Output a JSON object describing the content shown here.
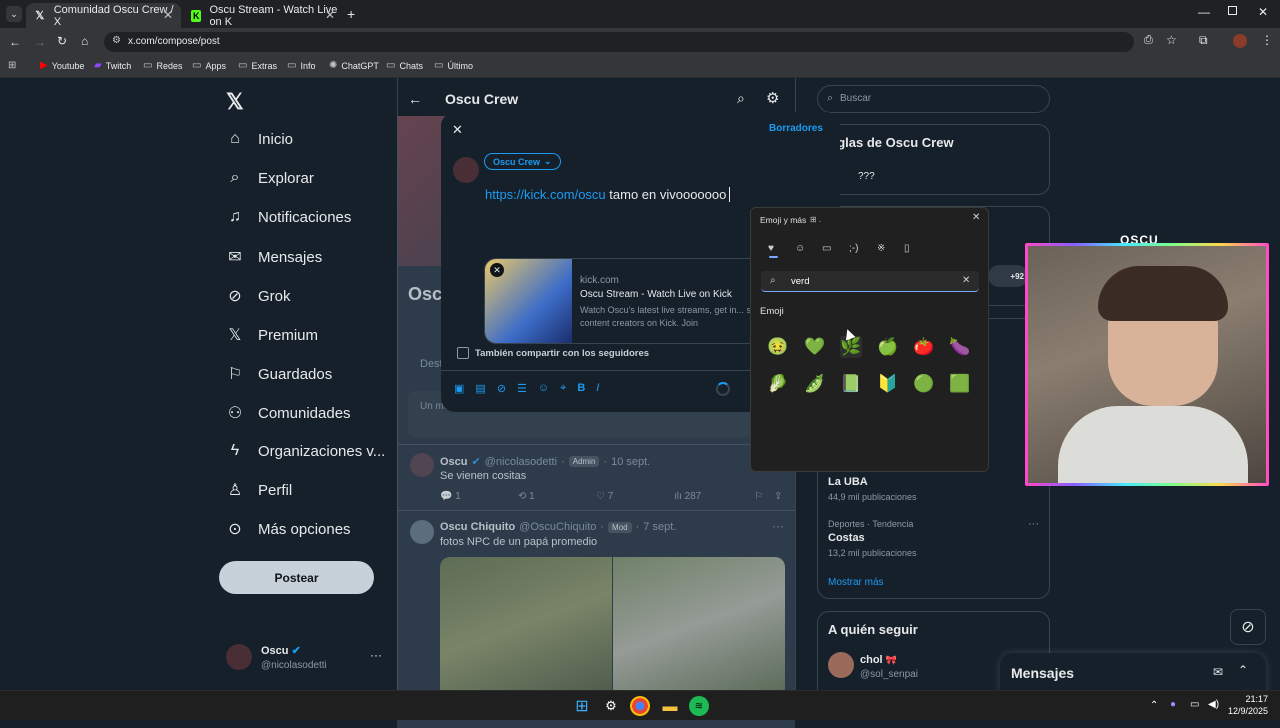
{
  "browser": {
    "tabs": [
      {
        "label": "Comunidad Oscu Crew / X",
        "icon": "x-logo-icon",
        "active": true
      },
      {
        "label": "Oscu Stream - Watch Live on K",
        "icon": "kick-logo-icon",
        "active": false
      }
    ],
    "url": "x.com/compose/post",
    "bookmarks": [
      {
        "label": "Youtube",
        "icon": "youtube-icon"
      },
      {
        "label": "Twitch",
        "icon": "twitch-icon"
      },
      {
        "label": "Redes",
        "icon": "folder-icon"
      },
      {
        "label": "Apps",
        "icon": "folder-icon"
      },
      {
        "label": "Extras",
        "icon": "folder-icon"
      },
      {
        "label": "Info",
        "icon": "folder-icon"
      },
      {
        "label": "ChatGPT",
        "icon": "chatgpt-icon"
      },
      {
        "label": "Chats",
        "icon": "folder-icon"
      },
      {
        "label": "Último",
        "icon": "folder-icon"
      }
    ]
  },
  "sidebar": {
    "items": [
      {
        "label": "Inicio",
        "icon": "home-icon"
      },
      {
        "label": "Explorar",
        "icon": "search-icon"
      },
      {
        "label": "Notificaciones",
        "icon": "bell-icon"
      },
      {
        "label": "Mensajes",
        "icon": "mail-icon"
      },
      {
        "label": "Grok",
        "icon": "grok-icon"
      },
      {
        "label": "Premium",
        "icon": "x-logo-icon"
      },
      {
        "label": "Guardados",
        "icon": "bookmark-icon"
      },
      {
        "label": "Comunidades",
        "icon": "people-icon"
      },
      {
        "label": "Organizaciones v...",
        "icon": "lightning-icon"
      },
      {
        "label": "Perfil",
        "icon": "person-icon"
      },
      {
        "label": "Más opciones",
        "icon": "more-circle-icon"
      }
    ],
    "post_button": "Postear",
    "account": {
      "name": "Oscu",
      "handle": "@nicolasodetti"
    }
  },
  "community": {
    "title": "Oscu Crew",
    "name_partial": "Osc",
    "tab_partial": "Dest",
    "notice": "Un moderador oculto este post por incumplir una regla de la Comunidad."
  },
  "composer": {
    "drafts": "Borradores",
    "audience": "Oscu Crew",
    "link_text": "https://kick.com/oscu",
    "text": " tamo en vivooooooo",
    "card": {
      "domain": "kick.com",
      "title": "Oscu Stream - Watch Live on Kick",
      "desc": "Watch Oscu's latest live streams, get in... support content creators on Kick. Join"
    },
    "share_label": "También compartir con los seguidores"
  },
  "posts": [
    {
      "name": "Oscu",
      "handle": "@nicolasodetti",
      "badge": "Admin",
      "date": "10 sept.",
      "text": "Se vienen cositas",
      "replies": "1",
      "reposts": "1",
      "likes": "7",
      "views": "287"
    },
    {
      "name": "Oscu Chiquito",
      "handle": "@OscuChiquito",
      "badge": "Mod",
      "date": "7 sept.",
      "text": "fotos NPC de un papá promedio"
    }
  ],
  "right": {
    "search_placeholder": "Buscar",
    "rules_title": "eglas de Oscu Crew",
    "rule1": "???",
    "avatars_count": "+92",
    "trends": [
      {
        "meta": "",
        "title": "La UBA",
        "count": "44,9 mil publicaciones"
      },
      {
        "meta": "Deportes · Tendencia",
        "title": "Costas",
        "count": "13,2 mil publicaciones"
      }
    ],
    "show_more": "Mostrar más",
    "follow_title": "A quién seguir",
    "follow_name": "chol",
    "follow_handle": "@sol_senpai",
    "messages_label": "Mensajes"
  },
  "emoji_panel": {
    "title": "Emoji y más",
    "search_value": "verd",
    "section": "Emoji",
    "emojis": [
      "🤢",
      "💚",
      "🌿",
      "🍏",
      "🍅",
      "🍆",
      "🥬",
      "🫛",
      "📗",
      "🔰",
      "🟢",
      "🟩"
    ]
  },
  "webcam": {
    "overlay_text": "OSCU"
  },
  "taskbar": {
    "time": "21:17",
    "date": "12/9/2025"
  }
}
